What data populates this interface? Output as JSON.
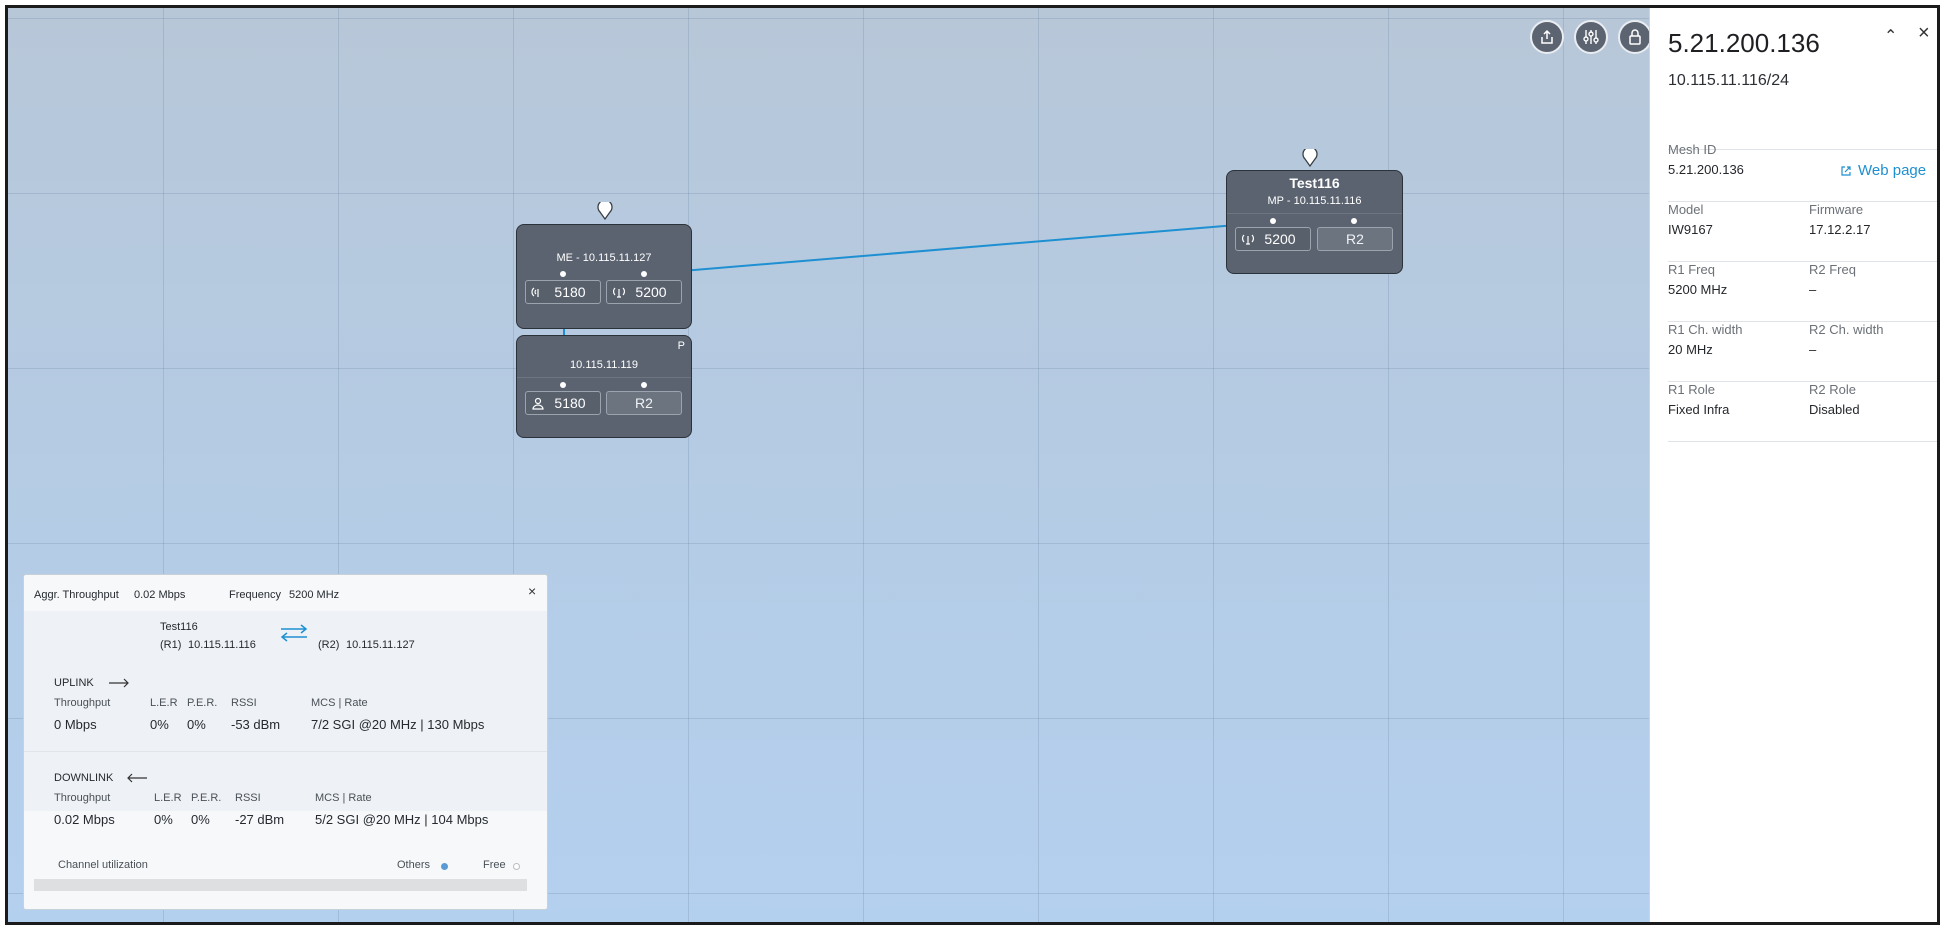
{
  "toolbar": {
    "buttons": [
      {
        "icon": "share-icon"
      },
      {
        "icon": "sliders-icon"
      },
      {
        "icon": "lock-icon"
      }
    ]
  },
  "nodes": {
    "me": {
      "subtitle": "ME - 10.115.11.127",
      "radio1": "5180",
      "radio2": "5200",
      "pin_icon": "location-pin-icon"
    },
    "p": {
      "flag": "P",
      "subtitle": "10.115.11.119",
      "radio1": "5180",
      "radio2": "R2"
    },
    "test116": {
      "name": "Test116",
      "subtitle": "MP - 10.115.11.116",
      "radio1": "5200",
      "radio2": "R2",
      "pin_icon": "location-pin-icon"
    }
  },
  "link_color": "#1e90d2",
  "panel": {
    "title": "5.21.200.136",
    "subtitle": "10.115.11.116/24",
    "mesh_id_label": "Mesh ID",
    "mesh_id": "5.21.200.136",
    "web_page": "Web page",
    "model_label": "Model",
    "model": "IW9167",
    "firmware_label": "Firmware",
    "firmware": "17.12.2.17",
    "r1_freq_label": "R1 Freq",
    "r1_freq": "5200 MHz",
    "r2_freq_label": "R2 Freq",
    "r2_freq": "–",
    "r1_ch_label": "R1 Ch. width",
    "r1_ch": "20 MHz",
    "r2_ch_label": "R2 Ch. width",
    "r2_ch": "–",
    "r1_role_label": "R1 Role",
    "r1_role": "Fixed Infra",
    "r2_role_label": "R2 Role",
    "r2_role": "Disabled"
  },
  "popup": {
    "aggr_label": "Aggr. Throughput",
    "aggr_value": "0.02 Mbps",
    "freq_label": "Frequency",
    "freq_value": "5200 MHz",
    "peer_name": "Test116",
    "r1_tag": "(R1)",
    "r1_ip": "10.115.11.116",
    "r2_tag": "(R2)",
    "r2_ip": "10.115.11.127",
    "uplink": {
      "title": "UPLINK",
      "throughput_label": "Throughput",
      "ler_label": "L.E.R",
      "per_label": "P.E.R.",
      "rssi_label": "RSSI",
      "mcs_label": "MCS | Rate",
      "throughput": "0 Mbps",
      "ler": "0%",
      "per": "0%",
      "rssi": "-53 dBm",
      "mcs": "7/2 SGI @20 MHz | 130 Mbps"
    },
    "downlink": {
      "title": "DOWNLINK",
      "throughput_label": "Throughput",
      "ler_label": "L.E.R",
      "per_label": "P.E.R.",
      "rssi_label": "RSSI",
      "mcs_label": "MCS | Rate",
      "throughput": "0.02 Mbps",
      "ler": "0%",
      "per": "0%",
      "rssi": "-27 dBm",
      "mcs": "5/2 SGI @20 MHz | 104 Mbps"
    },
    "channel_util_label": "Channel utilization",
    "others_label": "Others",
    "free_label": "Free",
    "others_color": "#5a9bd4",
    "free_color": "#c9cdd1"
  }
}
